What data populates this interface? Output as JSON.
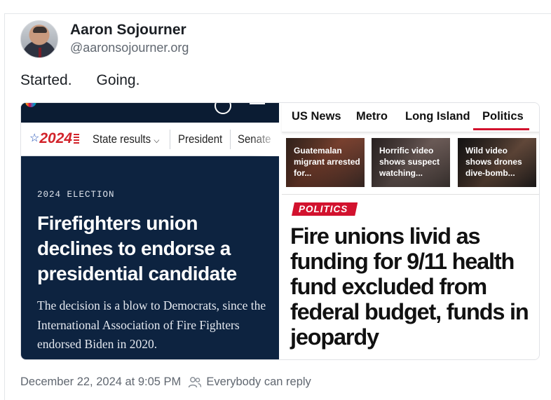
{
  "post": {
    "author_name": "Aaron Sojourner",
    "author_handle": "@aaronsojourner.org",
    "text": "Started.      Going.",
    "timestamp": "December 22, 2024 at 9:05 PM",
    "visibility": "Everybody can reply"
  },
  "left_card": {
    "badge_year": "2024",
    "nav": [
      "State results",
      "President",
      "Senate"
    ],
    "eyebrow": "2024 ELECTION",
    "headline": "Firefighters union declines to endorse a presidential candidate",
    "dek": "The decision is a blow to Democrats, since the International Association of Fire Fighters endorsed Biden in 2020.",
    "colors": {
      "background": "#0d2340",
      "badge_red": "#d2232a"
    }
  },
  "right_card": {
    "nav": [
      "US News",
      "Metro",
      "Long Island",
      "Politics"
    ],
    "active_nav": "Politics",
    "thumbs": [
      {
        "caption": "Guatemalan migrant arrested for..."
      },
      {
        "caption": "Horrific video shows suspect watching..."
      },
      {
        "caption": "Wild video shows drones dive-bomb..."
      }
    ],
    "tag": "POLITICS",
    "headline": "Fire unions livid as funding for 9/11 health fund excluded from federal budget, funds in jeopardy",
    "colors": {
      "accent": "#d2122e"
    }
  }
}
